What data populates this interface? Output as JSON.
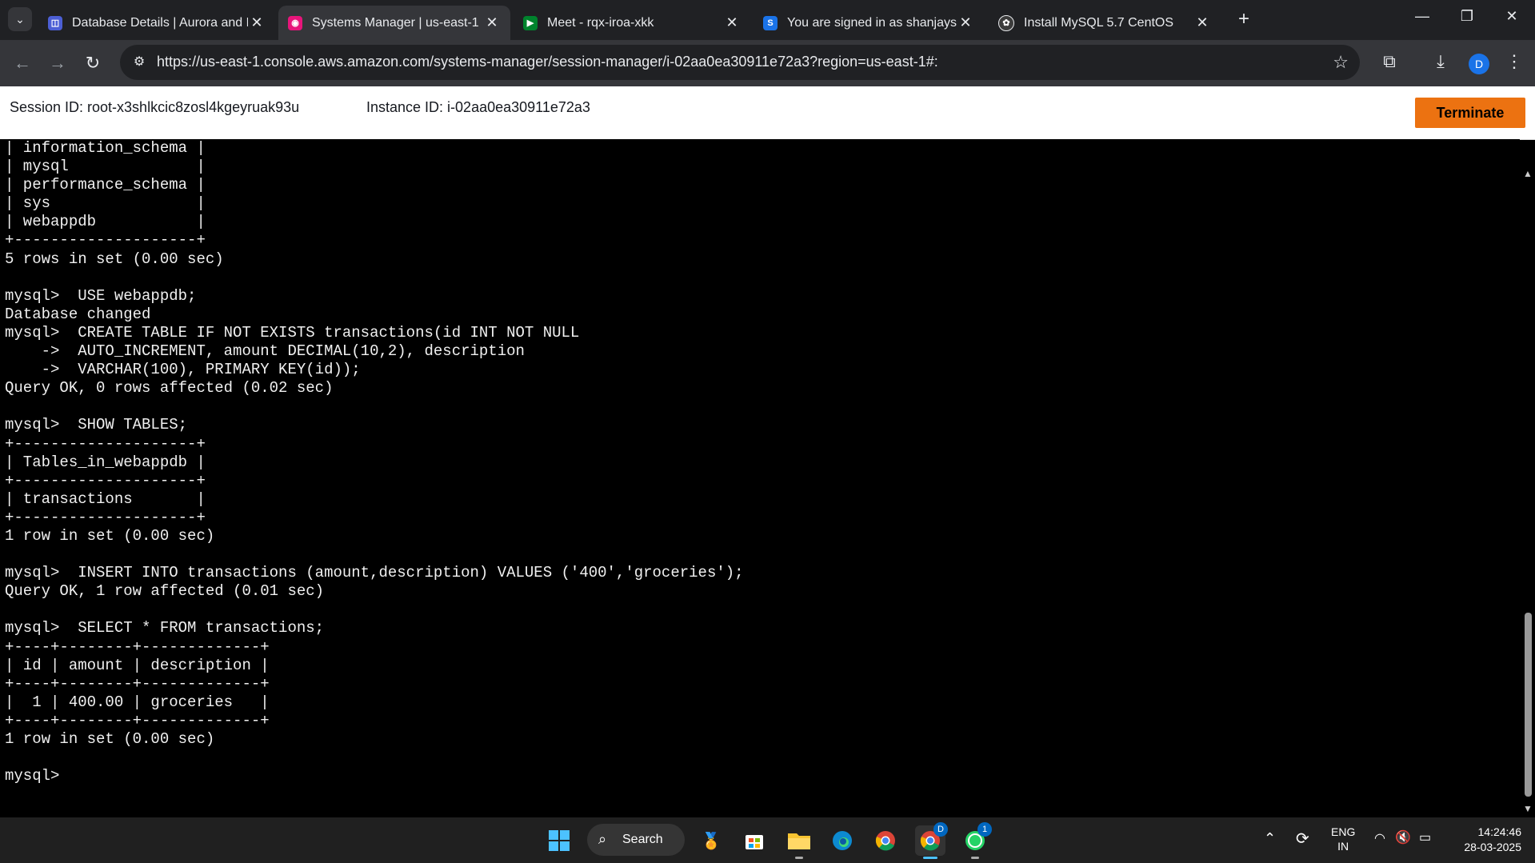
{
  "browser": {
    "tabs": [
      {
        "title": "Database Details | Aurora and R",
        "active": false,
        "icon": "rds-icon",
        "icon_color": "#4c5fd5"
      },
      {
        "title": "Systems Manager | us-east-1",
        "active": true,
        "icon": "ssm-icon",
        "icon_color": "#e7157b"
      },
      {
        "title": "Meet - rqx-iroa-xkk",
        "active": false,
        "icon": "meet-icon",
        "icon_color": "#00832d"
      },
      {
        "title": "You are signed in as shanjaysb",
        "active": false,
        "icon": "s-icon",
        "icon_color": "#1a73e8"
      },
      {
        "title": "Install MySQL 5.7 CentOS",
        "active": false,
        "icon": "chatgpt-icon",
        "icon_color": "#e8eaed"
      }
    ],
    "url": "https://us-east-1.console.aws.amazon.com/systems-manager/session-manager/i-02aa0ea30911e72a3?region=us-east-1#:",
    "profile_initial": "D"
  },
  "session": {
    "session_id": "Session ID: root-x3shlkcic8zosl4kgeyruak93u",
    "instance_id": "Instance ID: i-02aa0ea30911e72a3",
    "terminate_label": "Terminate"
  },
  "terminal": {
    "lines": [
      "| information_schema |",
      "| mysql              |",
      "| performance_schema |",
      "| sys                |",
      "| webappdb           |",
      "+--------------------+",
      "5 rows in set (0.00 sec)",
      "",
      "mysql>  USE webappdb;",
      "Database changed",
      "mysql>  CREATE TABLE IF NOT EXISTS transactions(id INT NOT NULL",
      "    ->  AUTO_INCREMENT, amount DECIMAL(10,2), description",
      "    ->  VARCHAR(100), PRIMARY KEY(id));",
      "Query OK, 0 rows affected (0.02 sec)",
      "",
      "mysql>  SHOW TABLES;",
      "+--------------------+",
      "| Tables_in_webappdb |",
      "+--------------------+",
      "| transactions       |",
      "+--------------------+",
      "1 row in set (0.00 sec)",
      "",
      "mysql>  INSERT INTO transactions (amount,description) VALUES ('400','groceries');",
      "Query OK, 1 row affected (0.01 sec)",
      "",
      "mysql>  SELECT * FROM transactions;",
      "+----+--------+-------------+",
      "| id | amount | description |",
      "+----+--------+-------------+",
      "|  1 | 400.00 | groceries   |",
      "+----+--------+-------------+",
      "1 row in set (0.00 sec)",
      "",
      "mysql> "
    ]
  },
  "taskbar": {
    "search_label": "Search",
    "language": "ENG",
    "region": "IN",
    "time": "14:24:46",
    "date": "28-03-2025",
    "whatsapp_badge": "1",
    "chrome_profile_badge": "D"
  }
}
